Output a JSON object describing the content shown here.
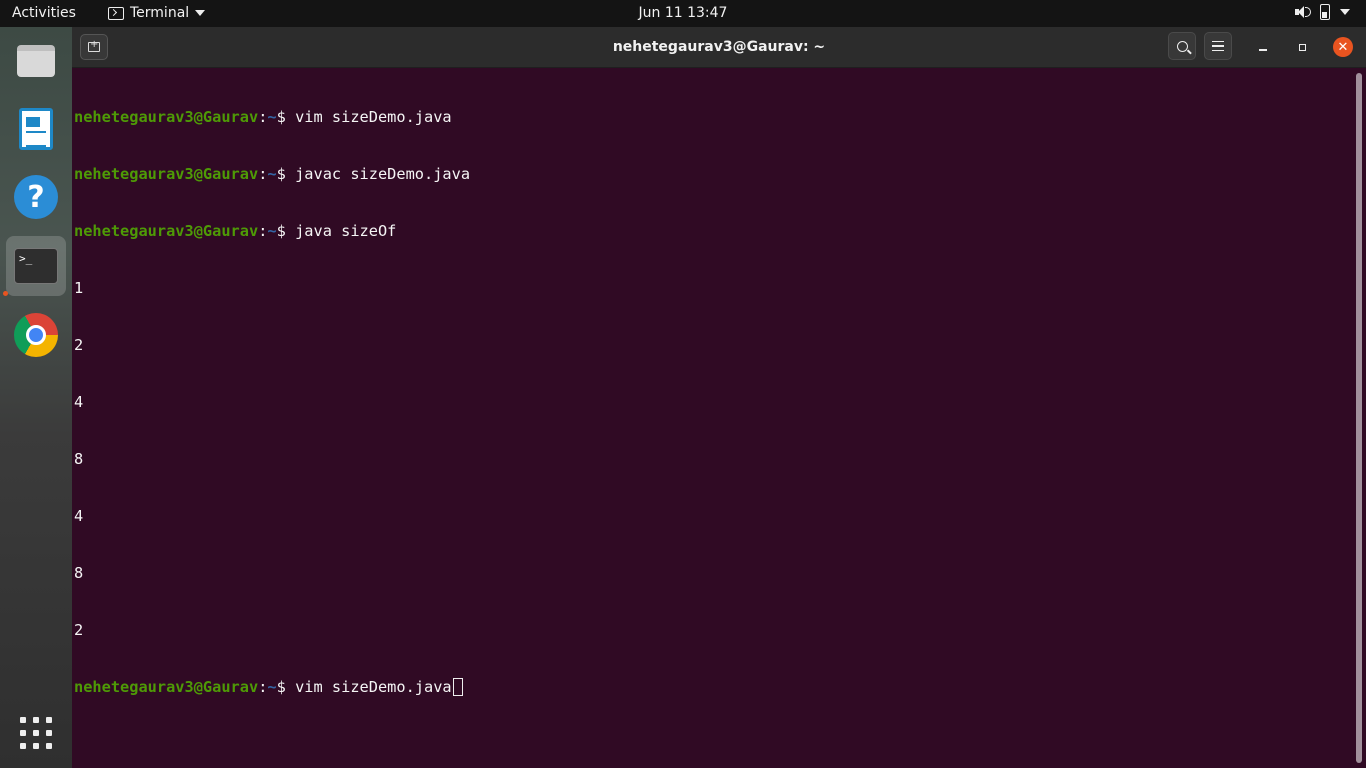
{
  "topbar": {
    "activities": "Activities",
    "app_name": "Terminal",
    "clock": "Jun 11  13:47"
  },
  "dock": {
    "items": [
      "files",
      "libreoffice-writer",
      "help",
      "terminal",
      "chrome",
      "show-applications"
    ]
  },
  "window": {
    "title": "nehetegaurav3@Gaurav: ~"
  },
  "terminal": {
    "user_host": "nehetegaurav3@Gaurav",
    "path": ":~",
    "prompt_symbol": "$ ",
    "commands": [
      "vim sizeDemo.java",
      "javac sizeDemo.java",
      "java sizeOf"
    ],
    "output": [
      "1",
      "2",
      "4",
      "8",
      "4",
      "8",
      "2"
    ],
    "current_command": "vim sizeDemo.java"
  },
  "colors": {
    "terminal_bg": "#300a24",
    "user_host": "#4e9a06",
    "path": "#3465a4",
    "close_button": "#e95420"
  }
}
